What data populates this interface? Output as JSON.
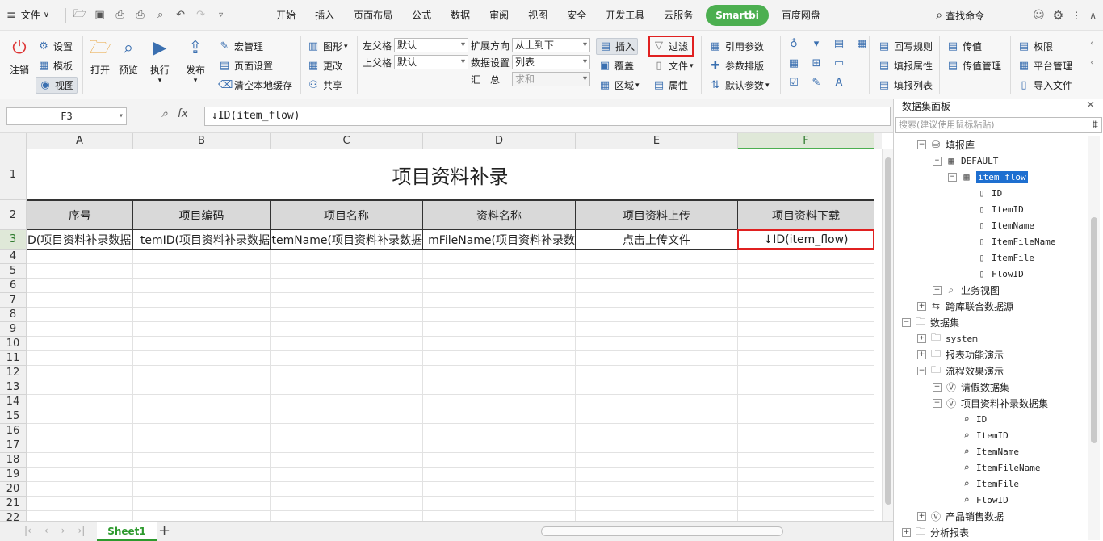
{
  "menubar": {
    "file_label": "文件",
    "tabs": [
      "开始",
      "插入",
      "页面布局",
      "公式",
      "数据",
      "审阅",
      "视图",
      "安全",
      "开发工具",
      "云服务",
      "Smartbi",
      "百度网盘"
    ],
    "active_tab": "Smartbi",
    "search_label": "查找命令"
  },
  "ribbon": {
    "logout": "注销",
    "settings": "设置",
    "template": "模板",
    "view": "视图",
    "open": "打开",
    "preview": "预览",
    "execute": "执行",
    "publish": "发布",
    "macro": "宏管理",
    "page_setup": "页面设置",
    "clear_cache": "清空本地缓存",
    "chart": "图形",
    "change": "更改",
    "share": "共享",
    "left_parent_label": "左父格",
    "left_parent_value": "默认",
    "top_parent_label": "上父格",
    "top_parent_value": "默认",
    "expand_dir_label": "扩展方向",
    "expand_dir_value": "从上到下",
    "data_setting_label": "数据设置",
    "data_setting_value": "列表",
    "summary_label": "汇　总",
    "summary_value": "求和",
    "insert": "插入",
    "overwrite": "覆盖",
    "region": "区域",
    "filter": "过滤",
    "file": "文件",
    "property": "属性",
    "ref_param": "引用参数",
    "param_layout": "参数排版",
    "default_param": "默认参数",
    "writeback_rule": "回写规则",
    "fill_property": "填报属性",
    "fill_list": "填报列表",
    "pass_value": "传值",
    "pass_value_mgmt": "传值管理",
    "permission": "权限",
    "platform_mgmt": "平台管理",
    "import_file": "导入文件"
  },
  "formula_bar": {
    "cell_ref": "F3",
    "fx": "fx",
    "formula": "↓ID(item_flow)"
  },
  "sheet": {
    "columns": [
      "A",
      "B",
      "C",
      "D",
      "E",
      "F"
    ],
    "rows": [
      "1",
      "2",
      "3",
      "4",
      "5",
      "6",
      "7",
      "8",
      "9",
      "10",
      "11",
      "12",
      "13",
      "14",
      "15",
      "16",
      "17",
      "18",
      "19",
      "20",
      "21",
      "22"
    ],
    "title": "项目资料补录",
    "headers": [
      "序号",
      "项目编码",
      "项目名称",
      "资料名称",
      "项目资料上传",
      "项目资料下载"
    ],
    "row3": [
      "D(项目资料补录数据",
      "temID(项目资料补录数据",
      "temName(项目资料补录数据",
      "mFileName(项目资料补录数",
      "点击上传文件",
      "↓ID(item_flow)"
    ],
    "active_tab": "Sheet1"
  },
  "panel": {
    "title": "数据集面板",
    "search_placeholder": "搜索(建议使用鼠标粘贴)",
    "tree": [
      {
        "label": "填报库",
        "level": 1,
        "toggle": "−",
        "icon": "db-icon"
      },
      {
        "label": "DEFAULT",
        "level": 2,
        "toggle": "−",
        "icon": "schema-icon",
        "mono": true
      },
      {
        "label": "item_flow",
        "level": 3,
        "toggle": "−",
        "icon": "table-icon",
        "mono": true,
        "selected": true
      },
      {
        "label": "ID",
        "level": 4,
        "icon": "field-icon",
        "mono": true
      },
      {
        "label": "ItemID",
        "level": 4,
        "icon": "field-icon",
        "mono": true
      },
      {
        "label": "ItemName",
        "level": 4,
        "icon": "field-icon",
        "mono": true
      },
      {
        "label": "ItemFileName",
        "level": 4,
        "icon": "field-icon",
        "mono": true
      },
      {
        "label": "ItemFile",
        "level": 4,
        "icon": "field-icon",
        "mono": true
      },
      {
        "label": "FlowID",
        "level": 4,
        "icon": "field-icon",
        "mono": true
      },
      {
        "label": "业务视图",
        "level": 2,
        "toggle": "+",
        "icon": "search-icon"
      },
      {
        "label": "跨库联合数据源",
        "level": 1,
        "toggle": "+",
        "icon": "join-icon"
      },
      {
        "label": "数据集",
        "level": 0,
        "toggle": "−",
        "icon": "folder-icon"
      },
      {
        "label": "system",
        "level": 1,
        "toggle": "+",
        "icon": "folder-icon",
        "mono": true
      },
      {
        "label": "报表功能演示",
        "level": 1,
        "toggle": "+",
        "icon": "folder-icon"
      },
      {
        "label": "流程效果演示",
        "level": 1,
        "toggle": "−",
        "icon": "folder-icon"
      },
      {
        "label": "请假数据集",
        "level": 2,
        "toggle": "+",
        "icon": "dataset-icon"
      },
      {
        "label": "项目资料补录数据集",
        "level": 2,
        "toggle": "−",
        "icon": "dataset-icon"
      },
      {
        "label": "ID",
        "level": 3,
        "icon": "field-search-icon",
        "mono": true
      },
      {
        "label": "ItemID",
        "level": 3,
        "icon": "field-search-icon",
        "mono": true
      },
      {
        "label": "ItemName",
        "level": 3,
        "icon": "field-search-icon",
        "mono": true
      },
      {
        "label": "ItemFileName",
        "level": 3,
        "icon": "field-search-icon",
        "mono": true
      },
      {
        "label": "ItemFile",
        "level": 3,
        "icon": "field-search-icon",
        "mono": true
      },
      {
        "label": "FlowID",
        "level": 3,
        "icon": "field-search-icon",
        "mono": true
      },
      {
        "label": "产品销售数据",
        "level": 1,
        "toggle": "+",
        "icon": "dataset-icon"
      },
      {
        "label": "分析报表",
        "level": 0,
        "toggle": "+",
        "icon": "folder-icon"
      }
    ]
  }
}
